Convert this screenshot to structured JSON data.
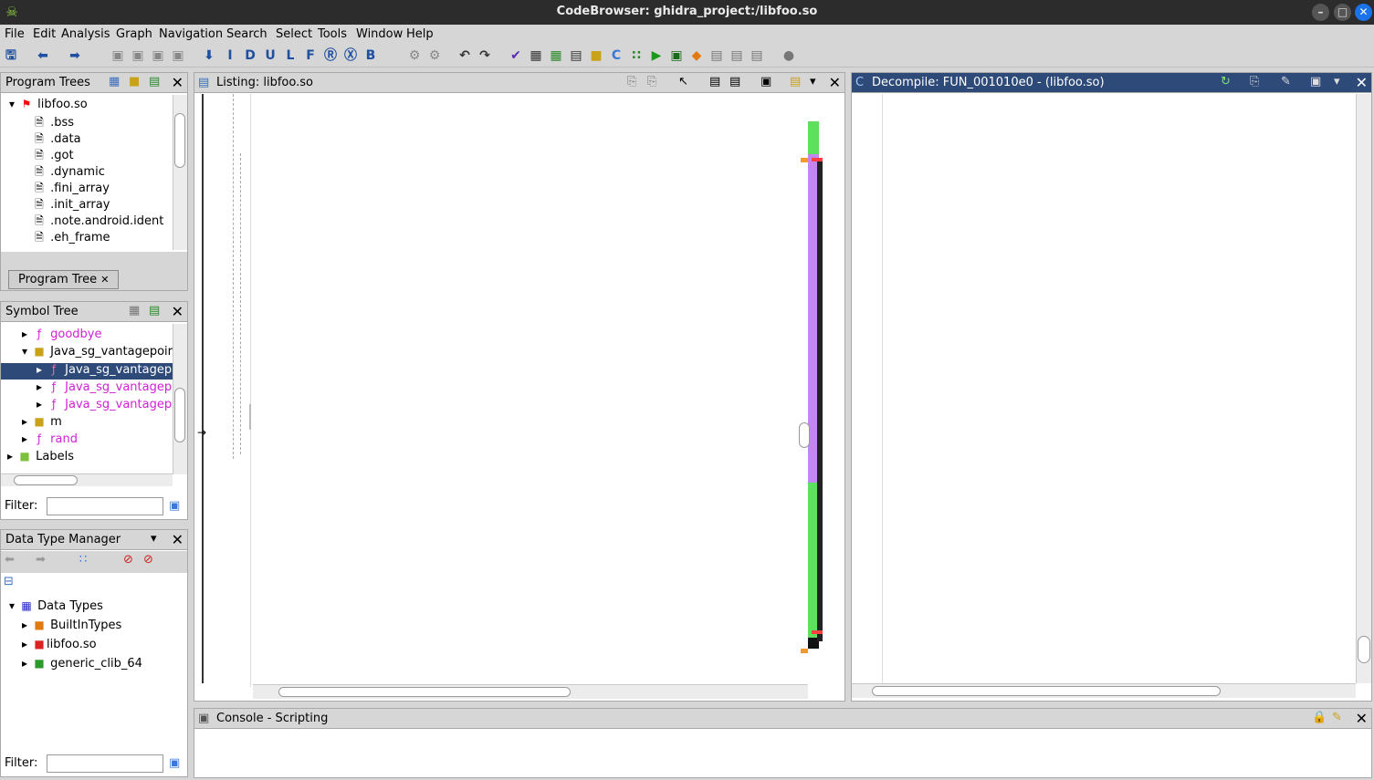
{
  "window": {
    "title": "CodeBrowser: ghidra_project:/libfoo.so"
  },
  "menu": [
    "File",
    "Edit",
    "Analysis",
    "Graph",
    "Navigation",
    "Search",
    "Select",
    "Tools",
    "Window",
    "Help"
  ],
  "program_trees": {
    "title": "Program Trees",
    "root": "libfoo.so",
    "items": [
      ".bss",
      ".data",
      ".got",
      ".dynamic",
      ".fini_array",
      ".init_array",
      ".note.android.ident",
      ".eh_frame"
    ],
    "tab": "Program Tree"
  },
  "symbol_tree": {
    "title": "Symbol Tree",
    "items": [
      "goodbye",
      "Java_sg_vantagepoir",
      "Java_sg_vantagep",
      "Java_sg_vantagep",
      "Java_sg_vantagep",
      "m",
      "rand",
      "Labels"
    ],
    "filter_label": "Filter:"
  },
  "dtm": {
    "title": "Data Type Manager",
    "root": "Data Types",
    "items": [
      "BuiltInTypes",
      "libfoo.so",
      "generic_clib_64"
    ],
    "filter_label": "Filter:"
  },
  "listing": {
    "title": "Listing:  libfoo.so"
  },
  "decompile": {
    "title": "Decompile: FUN_001010e0 -  (libfoo.so)"
  },
  "console": {
    "title": "Console - Scripting"
  },
  "colors": {
    "accent": "#2d4a79",
    "margin_green": "#5ee05e",
    "margin_purple": "#c386f0"
  }
}
